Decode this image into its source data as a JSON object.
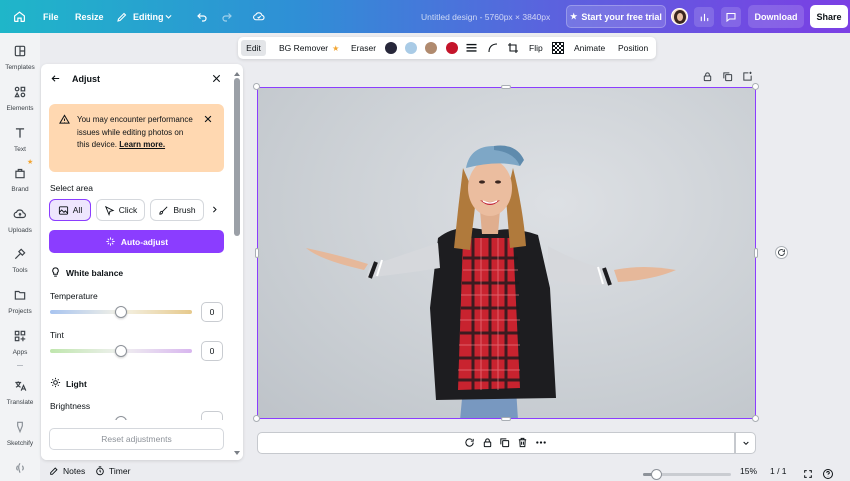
{
  "topbar": {
    "file_label": "File",
    "resize_label": "Resize",
    "editing_label": "Editing",
    "design_title": "Untitled design - 5760px × 3840px",
    "trial_label": "Start your free trial",
    "download_label": "Download",
    "share_label": "Share"
  },
  "rail": [
    {
      "label": "Templates",
      "icon": "templates-icon"
    },
    {
      "label": "Elements",
      "icon": "elements-icon"
    },
    {
      "label": "Text",
      "icon": "text-icon"
    },
    {
      "label": "Brand",
      "icon": "brand-icon"
    },
    {
      "label": "Uploads",
      "icon": "uploads-icon"
    },
    {
      "label": "Tools",
      "icon": "tools-icon"
    },
    {
      "label": "Projects",
      "icon": "projects-icon"
    },
    {
      "label": "Apps",
      "icon": "apps-icon"
    },
    {
      "label": "Translate",
      "icon": "translate-icon"
    },
    {
      "label": "Sketchify",
      "icon": "sketchify-icon"
    }
  ],
  "panel": {
    "title": "Adjust",
    "alert_text": "You may encounter performance issues while editing photos on this device.",
    "alert_link": "Learn more.",
    "select_area_label": "Select area",
    "area_all": "All",
    "area_click": "Click",
    "area_brush": "Brush",
    "auto_adjust_label": "Auto-adjust",
    "white_balance_label": "White balance",
    "temperature_label": "Temperature",
    "temperature_value": "0",
    "tint_label": "Tint",
    "tint_value": "0",
    "light_label": "Light",
    "brightness_label": "Brightness",
    "reset_label": "Reset adjustments"
  },
  "context_toolbar": {
    "edit_label": "Edit",
    "bg_remover_label": "BG Remover",
    "eraser_label": "Eraser",
    "flip_label": "Flip",
    "animate_label": "Animate",
    "position_label": "Position",
    "swatches": [
      "#27273a",
      "#a9cbe6",
      "#b08a6e",
      "#c4142a"
    ]
  },
  "footer": {
    "notes_label": "Notes",
    "timer_label": "Timer",
    "zoom_label": "15%",
    "page_label": "1 / 1"
  },
  "colors": {
    "accent": "#8b3dff",
    "alert_bg": "#ffd8b1"
  }
}
